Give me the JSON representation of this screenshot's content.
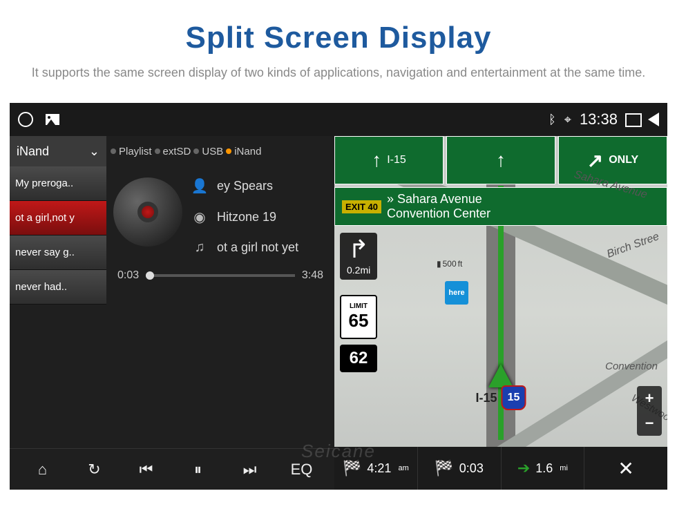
{
  "hero": {
    "title": "Split Screen Display",
    "subtitle": "It supports the same screen display of two kinds of applications, navigation and entertainment at the same time."
  },
  "statusbar": {
    "time": "13:38"
  },
  "music": {
    "source_label": "iNand",
    "playlist": [
      "My preroga..",
      "ot a girl,not y",
      "never say g..",
      "never had.."
    ],
    "tabs": [
      "Playlist",
      "extSD",
      "USB",
      "iNand"
    ],
    "artist": "ey Spears",
    "album": "Hitzone 19",
    "track": "ot a girl not yet",
    "time_cur": "0:03",
    "time_total": "3:48",
    "eq_label": "EQ"
  },
  "nav": {
    "highway": "I-15",
    "only_label": "ONLY",
    "exit_tag": "EXIT 40",
    "exit_dest_line1": "» Sahara Avenue",
    "exit_dest_line2": "Convention Center",
    "turn_dist": "0.2",
    "turn_unit": "mi",
    "marker_dist": "500",
    "marker_unit": "ft",
    "limit_label": "LIMIT",
    "limit_val": "65",
    "speed": "62",
    "here_label": "here",
    "road_labels": {
      "a": "Sahara Avenue",
      "b": "Birch Stree",
      "c": "Convention",
      "d": "Westwoo"
    },
    "shield_label": "I-15",
    "shield_num": "15",
    "bottom": {
      "arrival": "4:21",
      "arrival_suffix": "am",
      "elapsed": "0:03",
      "remaining": "1.6",
      "remaining_unit": "mi"
    }
  },
  "watermark": "Seicane"
}
